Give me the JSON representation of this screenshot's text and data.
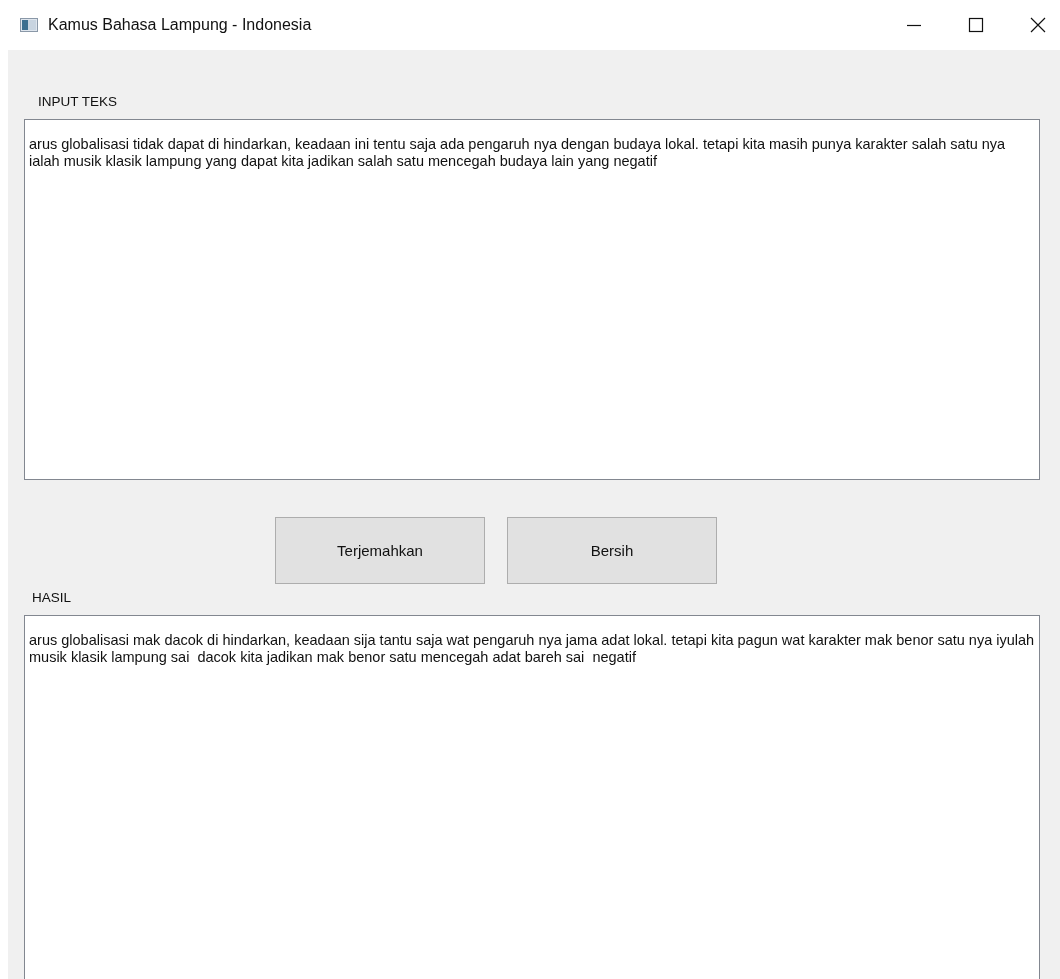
{
  "window": {
    "title": "Kamus Bahasa Lampung - Indonesia"
  },
  "input": {
    "label": "INPUT TEKS",
    "value": "arus globalisasi tidak dapat di hindarkan, keadaan ini tentu saja ada pengaruh nya dengan budaya lokal. tetapi kita masih punya karakter salah satu nya ialah musik klasik lampung yang dapat kita jadikan salah satu mencegah budaya lain yang negatif"
  },
  "buttons": [
    "Terjemahkan",
    "Bersih"
  ],
  "output": {
    "label": "HASIL",
    "value": "arus globalisasi mak dacok di hindarkan, keadaan sija tantu saja wat pengaruh nya jama adat lokal. tetapi kita pagun wat karakter mak benor satu nya iyulah musik klasik lampung sai  dacok kita jadikan mak benor satu mencegah adat bareh sai  negatif"
  }
}
